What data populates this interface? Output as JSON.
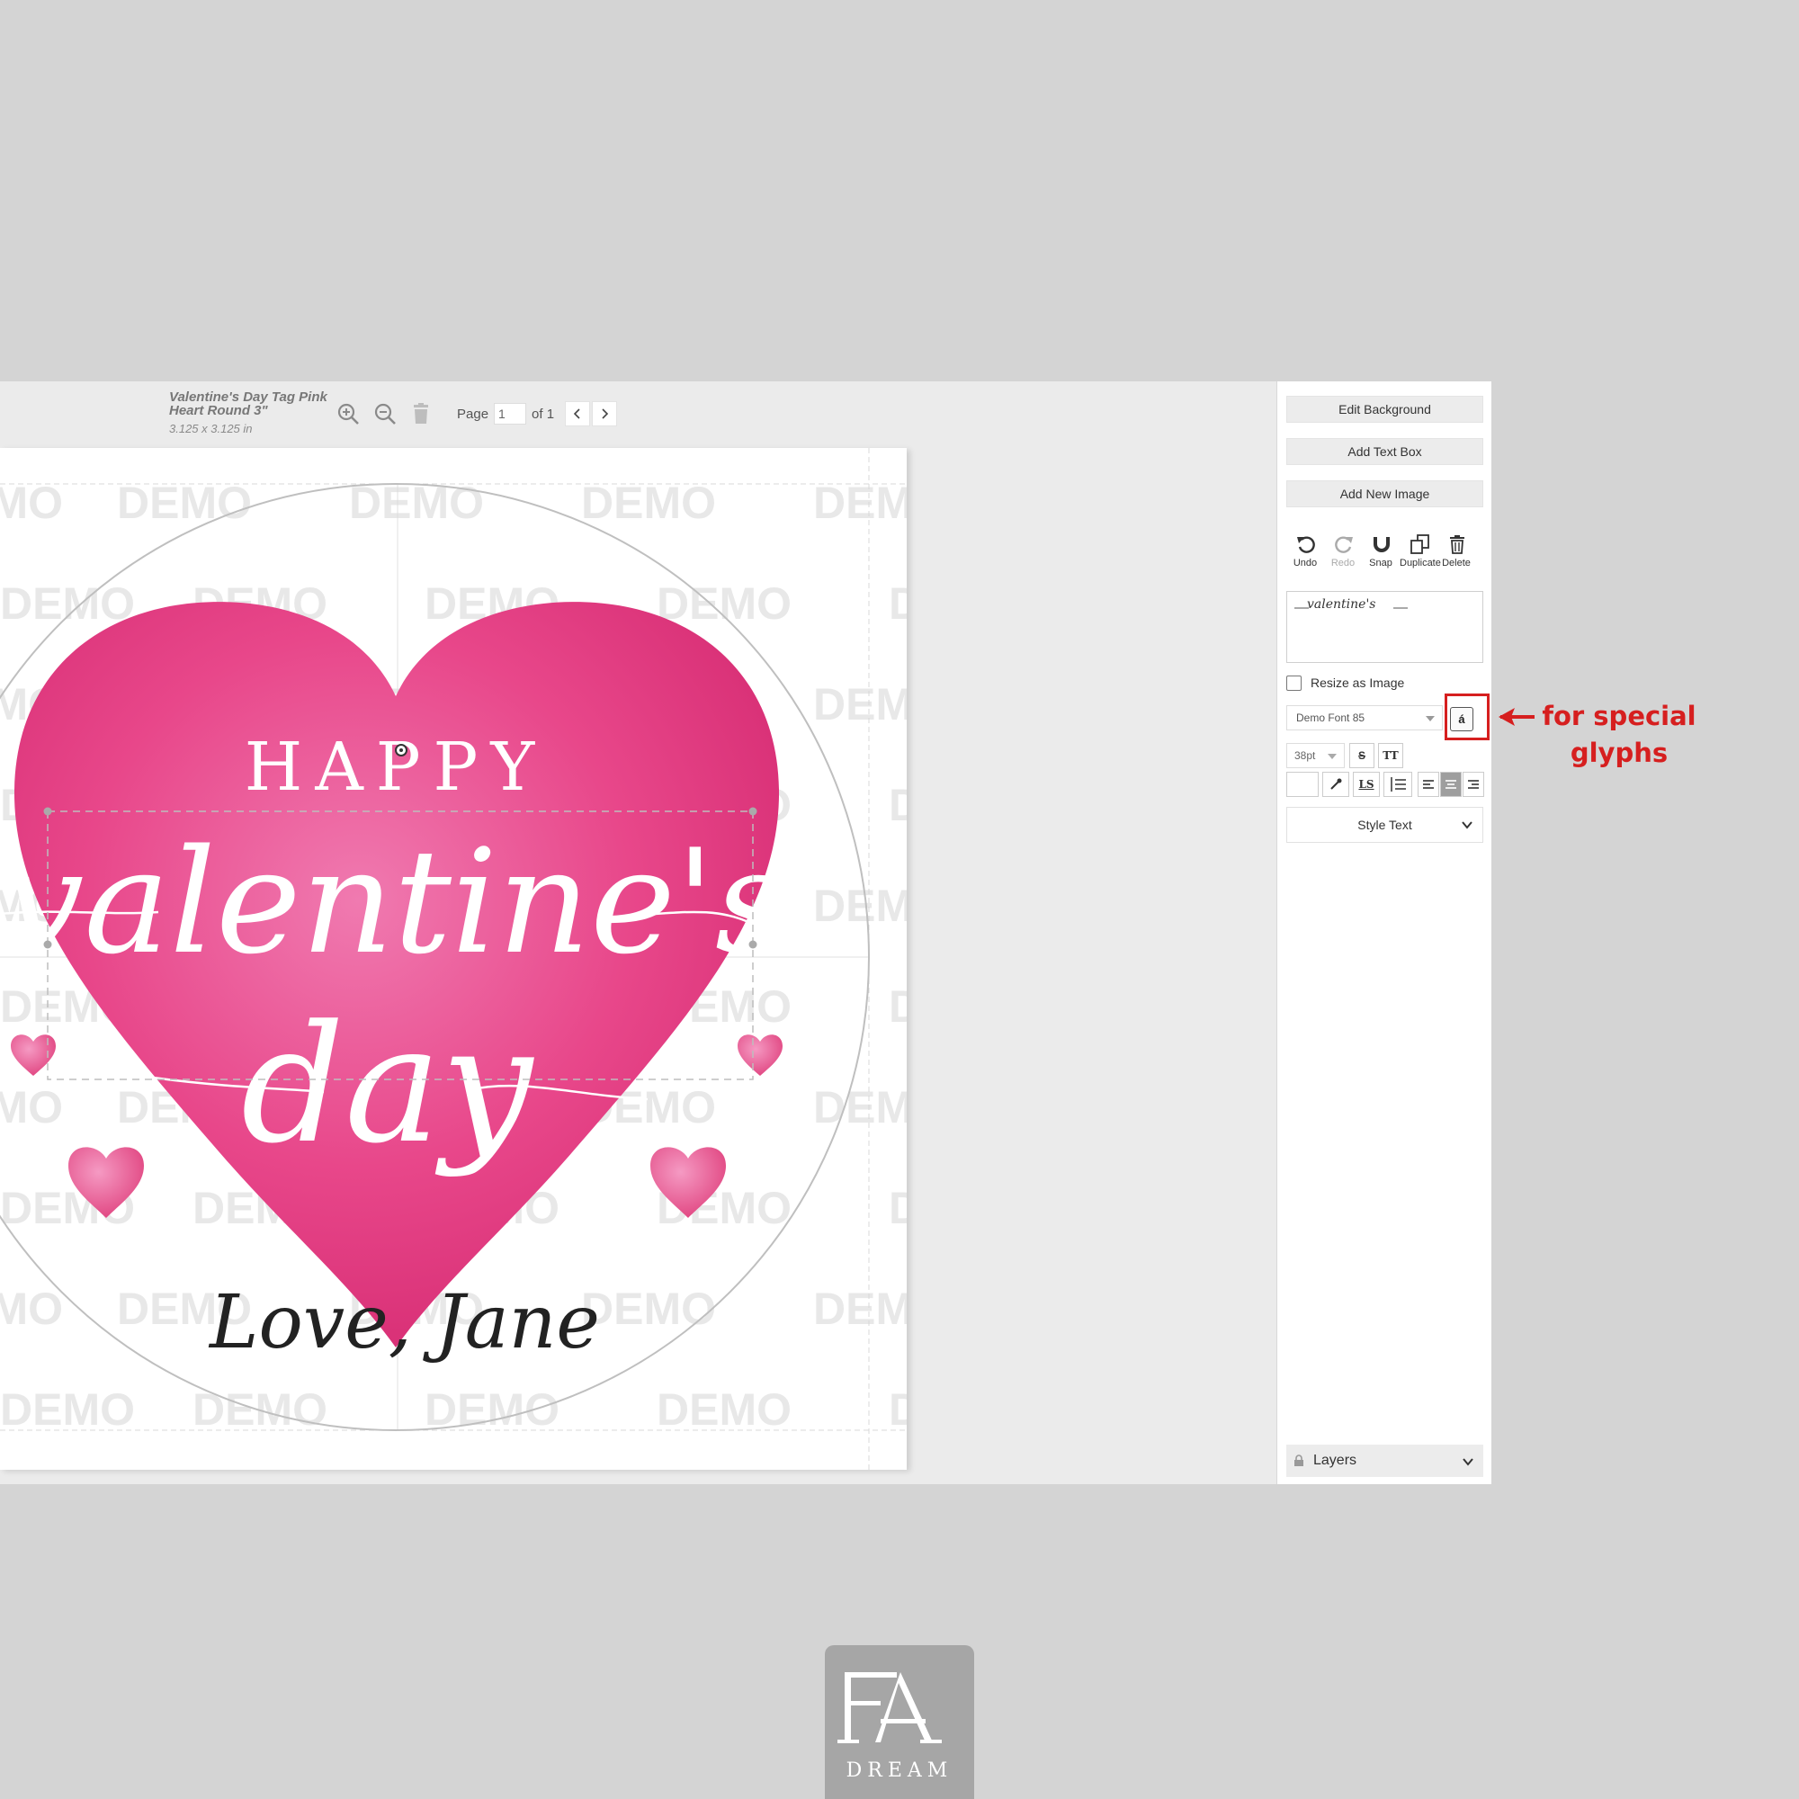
{
  "document": {
    "title": "Valentine's Day Tag Pink Heart Round 3\"",
    "size": "3.125 x 3.125 in"
  },
  "toolbar": {
    "page_label": "Page",
    "page_value": "1",
    "of_label": "of 1",
    "icons": [
      "zoom-in-icon",
      "zoom-out-icon",
      "trash-icon",
      "chevron-left-icon",
      "chevron-right-icon"
    ]
  },
  "design": {
    "watermark": "DEMO",
    "line1": "HAPPY",
    "line2": "valentine's",
    "line3": "day",
    "signature": "Love, Jane"
  },
  "sidebar": {
    "edit_background": "Edit Background",
    "add_text_box": "Add Text Box",
    "add_new_image": "Add New Image",
    "actions": [
      {
        "label": "Undo",
        "icon": "undo-icon"
      },
      {
        "label": "Redo",
        "icon": "redo-icon"
      },
      {
        "label": "Snap",
        "icon": "magnet-icon"
      },
      {
        "label": "Duplicate",
        "icon": "duplicate-icon"
      },
      {
        "label": "Delete",
        "icon": "trash-icon"
      }
    ],
    "text_preview": "valentine's",
    "resize_as_image": "Resize as Image",
    "font": "Demo Font 85",
    "glyph_button": "á",
    "font_size": "38pt",
    "format_buttons": [
      "S",
      "TT",
      "LS"
    ],
    "style_text": "Style Text",
    "layers": "Layers"
  },
  "callout": {
    "line1": "for special",
    "line2": "glyphs"
  },
  "logo": {
    "word": "DREAM"
  },
  "colors": {
    "heart_pink": "#e8478a",
    "callout_red": "#d61f1f",
    "editor_bg": "#ebebeb",
    "page_bg": "#d4d4d4"
  }
}
